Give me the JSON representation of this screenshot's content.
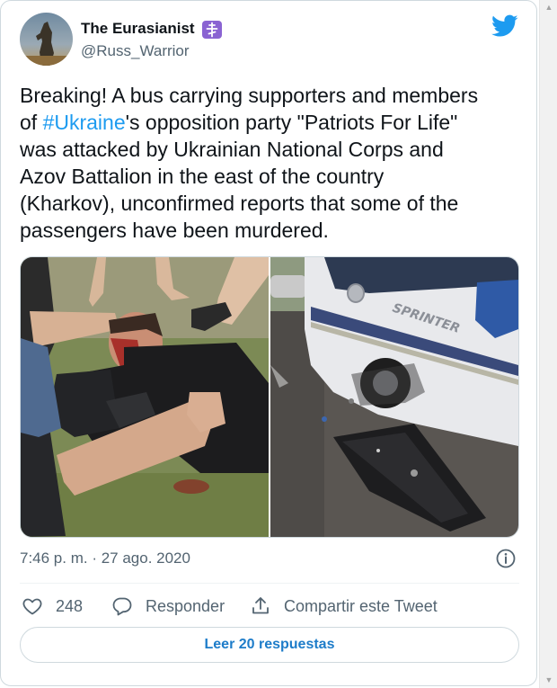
{
  "author": {
    "display_name": "The Eurasianist",
    "handle": "@Russ_Warrior",
    "avatar": "avatar-statue-image",
    "badge": "orthodox-cross-icon",
    "badge_color": "#8a63d2"
  },
  "brand": {
    "icon": "twitter-bird-icon",
    "color": "#1d9bf0"
  },
  "tweet": {
    "lines": [
      {
        "before": "Breaking! A bus carrying supporters and members",
        "hashtag": "",
        "after": ""
      },
      {
        "before": "of ",
        "hashtag": "#Ukraine",
        "after": "'s opposition party \"Patriots For Life\""
      },
      {
        "before": "was attacked by Ukrainian National Corps and",
        "hashtag": "",
        "after": ""
      },
      {
        "before": "Azov Battalion in the east of the country",
        "hashtag": "",
        "after": ""
      },
      {
        "before": "(Kharkov), unconfirmed reports that some of the",
        "hashtag": "",
        "after": ""
      },
      {
        "before": "passengers have been murdered.",
        "hashtag": "",
        "after": ""
      }
    ],
    "hashtag_color": "#1d9bf0",
    "media": [
      {
        "name": "injured-man-photo",
        "alt": ""
      },
      {
        "name": "damaged-bus-photo",
        "bus_lettering": "SPRINTER"
      }
    ],
    "timestamp": "7:46 p. m. · 27 ago. 2020"
  },
  "actions": {
    "like_count": "248",
    "reply_label": "Responder",
    "share_label": "Compartir este Tweet",
    "read_replies_label": "Leer 20 respuestas"
  },
  "icons": [
    "heart-icon",
    "reply-bubble-icon",
    "share-icon",
    "info-icon"
  ],
  "colors": {
    "text": "#0f1419",
    "secondary_text": "#536471",
    "border": "#cfd9de",
    "link_button_text": "#1d7cc9"
  }
}
